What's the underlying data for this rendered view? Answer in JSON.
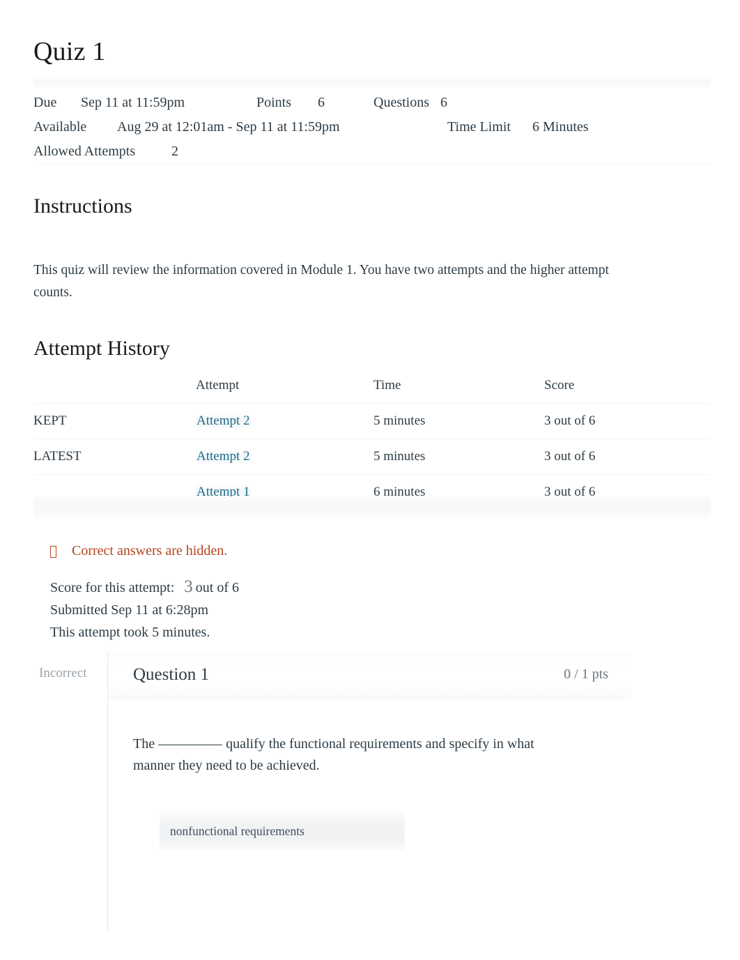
{
  "quiz": {
    "title": "Quiz 1"
  },
  "meta": {
    "due_label": "Due",
    "due_value": "Sep 11 at 11:59pm",
    "points_label": "Points",
    "points_value": "6",
    "questions_label": "Questions",
    "questions_value": "6",
    "available_label": "Available",
    "available_value": "Aug 29 at 12:01am - Sep 11 at 11:59pm",
    "time_limit_label": "Time Limit",
    "time_limit_value": "6 Minutes",
    "allowed_attempts_label": "Allowed Attempts",
    "allowed_attempts_value": "2"
  },
  "instructions": {
    "heading": "Instructions",
    "body": "This quiz will review the information covered in Module 1. You have two attempts and the higher attempt counts."
  },
  "attempt_history": {
    "heading": "Attempt History",
    "columns": {
      "label": "",
      "attempt": "Attempt",
      "time": "Time",
      "score": "Score"
    },
    "rows": [
      {
        "label": "KEPT",
        "attempt": "Attempt 2",
        "time": "5 minutes",
        "score": "3 out of 6"
      },
      {
        "label": "LATEST",
        "attempt": "Attempt 2",
        "time": "5 minutes",
        "score": "3 out of 6"
      },
      {
        "label": "",
        "attempt": "Attempt 1",
        "time": "6 minutes",
        "score": "3 out of 6"
      }
    ]
  },
  "notice": {
    "icon": "missing-glyph-icon",
    "text": "Correct answers are hidden.",
    "color": "#b5431c"
  },
  "attempt_summary": {
    "score_label": "Score for this attempt:",
    "score_value": "3",
    "score_suffix": "out of 6",
    "submitted": "Submitted Sep 11 at 6:28pm",
    "duration": "This attempt took 5 minutes."
  },
  "question": {
    "status": "Incorrect",
    "name": "Question 1",
    "points": "0 / 1 pts",
    "text_before_blank": "The",
    "text_after_blank": "qualify the functional requirements and specify in what manner they need to be achieved.",
    "selected_answer": "nonfunctional requirements"
  },
  "colors": {
    "link": "#1f6b8c",
    "notice": "#b5431c",
    "text": "#2d3b45",
    "muted": "#9aa3a9"
  }
}
